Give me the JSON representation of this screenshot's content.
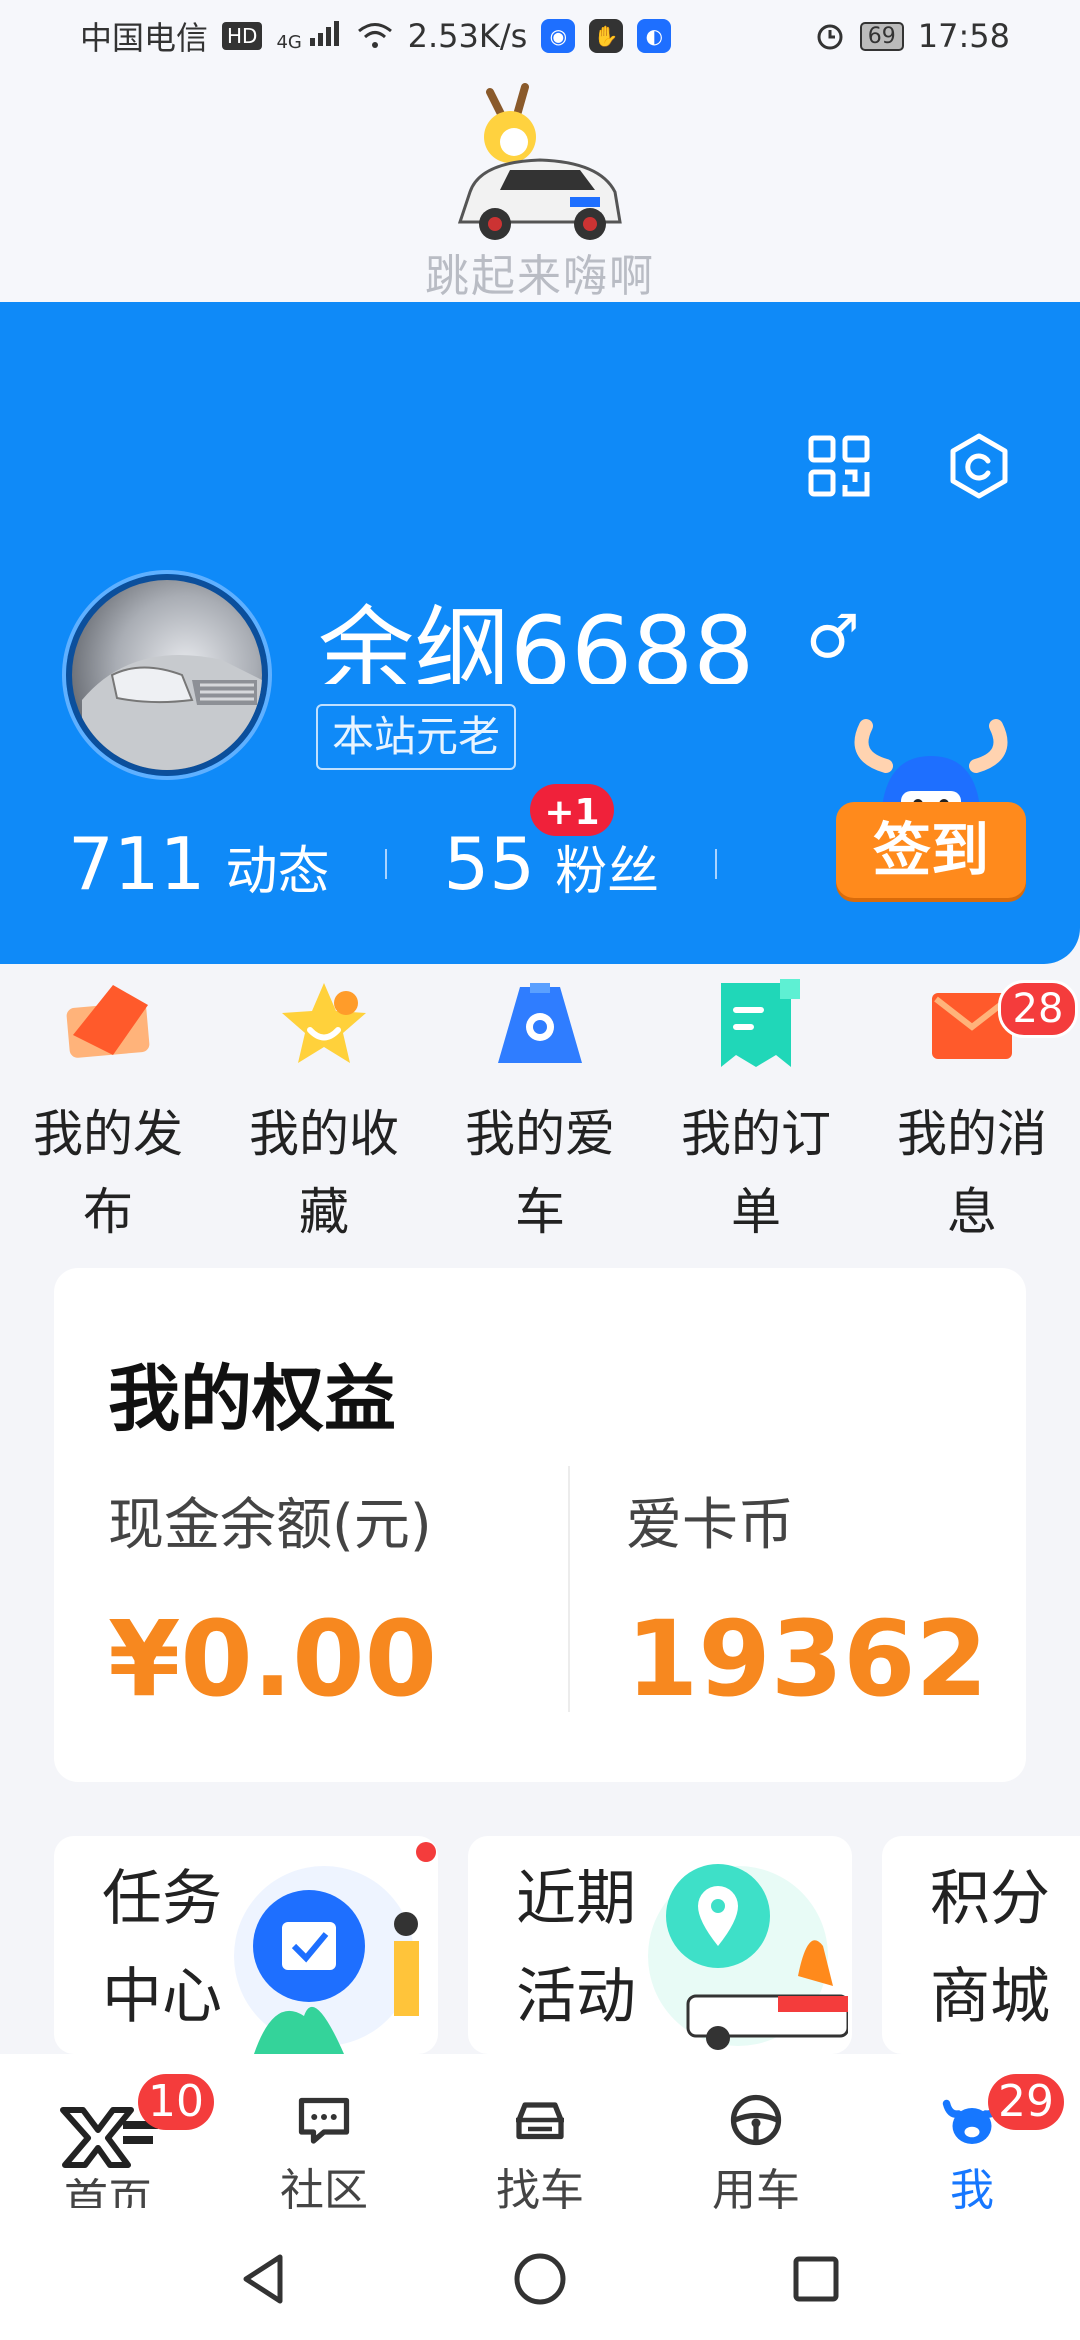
{
  "status_bar": {
    "carrier": "中国电信",
    "hd": "HD",
    "network": "4G",
    "speed": "2.53K/s",
    "battery": "69",
    "time": "17:58"
  },
  "mascot": {
    "caption": "跳起来嗨啊"
  },
  "profile": {
    "username": "余纲6688",
    "gender": "♂",
    "tag": "本站元老",
    "stats": [
      {
        "value": "711",
        "label": "动态"
      },
      {
        "value": "55",
        "label": "粉丝"
      }
    ],
    "new_fans_badge": "+1",
    "checkin_label": "签到"
  },
  "quick_links": [
    {
      "label": "我的发布",
      "icon": "edit-icon"
    },
    {
      "label": "我的收藏",
      "icon": "star-icon"
    },
    {
      "label": "我的爱车",
      "icon": "car-icon"
    },
    {
      "label": "我的订单",
      "icon": "order-icon"
    },
    {
      "label": "我的消息",
      "icon": "message-icon",
      "badge": "28"
    }
  ],
  "rights": {
    "title": "我的权益",
    "cash_label": "现金余额(元)",
    "cash_value": "¥0.00",
    "coin_label": "爱卡币",
    "coin_value": "19362"
  },
  "cards": [
    {
      "title": "任务中心"
    },
    {
      "title": "近期活动"
    },
    {
      "title": "积分商城"
    }
  ],
  "tabs": [
    {
      "label": "首页",
      "badge": "10"
    },
    {
      "label": "社区"
    },
    {
      "label": "找车"
    },
    {
      "label": "用车"
    },
    {
      "label": "我",
      "badge": "29",
      "active": true
    }
  ],
  "colors": {
    "primary_blue": "#0f8af8",
    "accent_orange": "#f7881f",
    "badge_red": "#f43c3c",
    "active_tab": "#1677ff"
  }
}
